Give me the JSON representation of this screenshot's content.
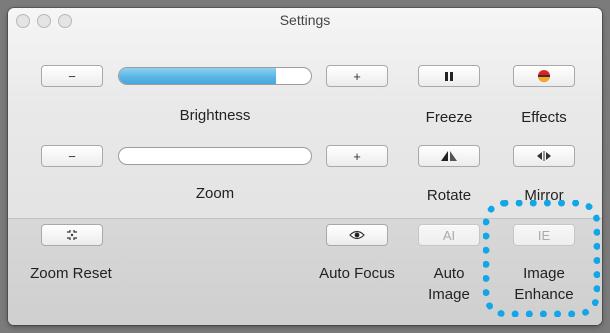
{
  "window": {
    "title": "Settings"
  },
  "brightness": {
    "label": "Brightness",
    "minus": "−",
    "plus": "+",
    "level": 0.82
  },
  "zoom": {
    "label": "Zoom",
    "minus": "−",
    "plus": "+",
    "level": 0.0
  },
  "freeze": {
    "label": "Freeze",
    "icon": "pause-icon"
  },
  "effects": {
    "label": "Effects",
    "icon": "effects-icon"
  },
  "rotate": {
    "label": "Rotate",
    "icon": "rotate-icon"
  },
  "mirror": {
    "label": "Mirror",
    "icon": "mirror-icon"
  },
  "zoom_reset": {
    "label": "Zoom Reset",
    "icon": "zoom-reset-icon"
  },
  "auto_focus": {
    "label": "Auto Focus",
    "icon": "eye-icon"
  },
  "auto_image": {
    "label_line1": "Auto",
    "label_line2": "Image",
    "button": "AI"
  },
  "image_enhance": {
    "label_line1": "Image",
    "label_line2": "Enhance",
    "button": "IE"
  },
  "colors": {
    "accent": "#10a6e8",
    "slider_fill": "#55b4e6"
  }
}
